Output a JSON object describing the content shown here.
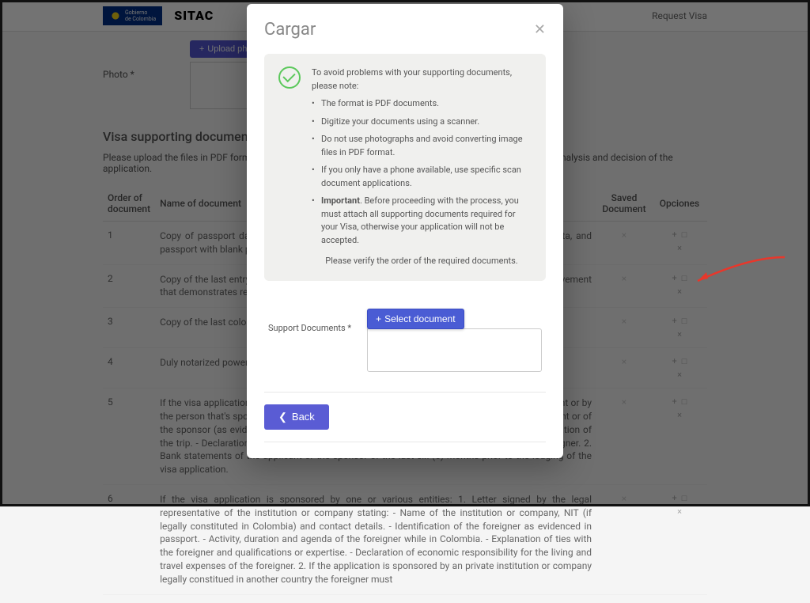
{
  "header": {
    "brand": "SITAC",
    "request_visa": "Request Visa"
  },
  "photo": {
    "label": "Photo *",
    "upload_label": "Upload photo"
  },
  "section": {
    "title": "Visa supporting documents",
    "desc": "Please upload the files in PDF format, in the order given below. The documents registered will be key for the analysis and decision of the application."
  },
  "table": {
    "col_order": "Order of document",
    "col_name": "Name of document",
    "col_saved": "Saved Document",
    "col_options": "Opciones",
    "rows": [
      {
        "n": "1",
        "doc": "Copy of passport data page: main page of the passport containing the holder's personal data, and passport with blank pages to stamp the visa."
      },
      {
        "n": "2",
        "doc": "Copy of the last entry and departure stamps in the passport, in order to verify the migratory movement that demonstrates regular visits."
      },
      {
        "n": "3",
        "doc": "Copy of the last colombian visa, if applicable."
      },
      {
        "n": "4",
        "doc": "Duly notarized power of attorney signed by the legal representative."
      },
      {
        "n": "5",
        "doc": "If the visa application is sponsored by one or various foreigners: 1. Letter signed by the applicant or by the person that's sponsoring containing the following information: - Name and ID of the applicant or of the sponsor (as evidenced in passport). - Activity, duration and agenda of the foreigner, motivation of the trip. - Declaration of economic responsibility for the living and travel expenses of the foreigner. 2. Bank statements of the applicant or the sponsor of the last six (6) months prior to the lodging of the visa application."
      },
      {
        "n": "6",
        "doc": "If the visa application is sponsored by one or various entities: 1. Letter signed by the legal representative of the institution or company stating: - Name of the institution or company, NIT (if legally constituted in Colombia) and contact details. - Identification of the foreigner as evidenced in passport. - Activity, duration and agenda of the foreigner while in Colombia. - Explanation of ties with the foreigner and qualifications or expertise. - Declaration of economic responsibility for the living and travel expenses of the foreigner. 2. If the application is sponsored by an private institution or company legally constitued in another country the foreigner must"
      }
    ]
  },
  "modal": {
    "title": "Cargar",
    "note_intro": "To avoid problems with your supporting documents, please note:",
    "bullets": [
      "The format is PDF documents.",
      "Digitize your documents using a scanner.",
      "Do not use photographs and avoid converting image files in PDF format.",
      "If you only have a phone available, use specific scan document applications.",
      "Important. Before proceeding with the process, you must attach all supporting documents required for your Visa, otherwise your application will not be accepted."
    ],
    "verify": "Please verify the order of the required documents.",
    "support_label": "Support Documents *",
    "select_doc": "Select document",
    "back": "Back"
  }
}
